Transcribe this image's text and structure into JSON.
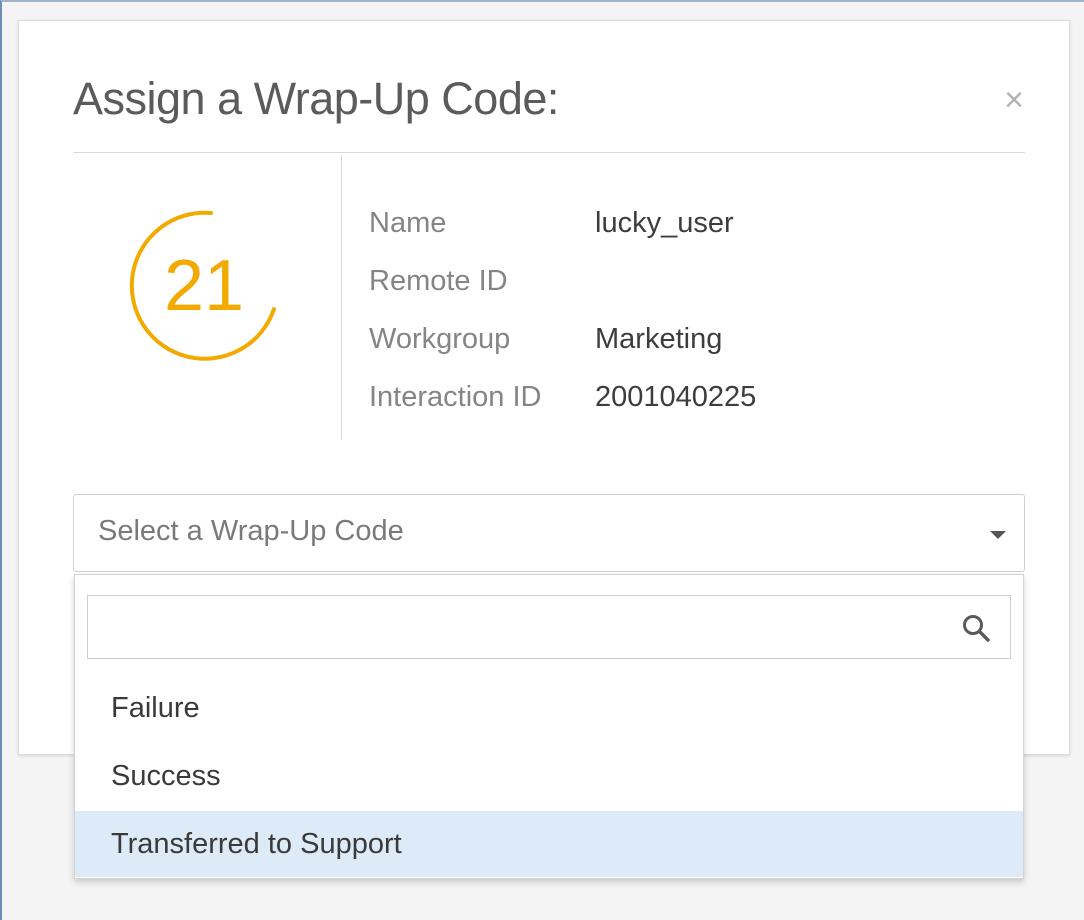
{
  "dialog": {
    "title": "Assign a Wrap-Up Code:",
    "close_label": "×"
  },
  "counter": {
    "value": "21",
    "color": "#f2a900"
  },
  "info": {
    "rows": [
      {
        "label": "Name",
        "value": "lucky_user"
      },
      {
        "label": "Remote ID",
        "value": ""
      },
      {
        "label": "Workgroup",
        "value": "Marketing"
      },
      {
        "label": "Interaction ID",
        "value": "2001040225"
      }
    ]
  },
  "select": {
    "placeholder": "Select a Wrap-Up Code",
    "icon": "chevron-down-icon"
  },
  "dropdown": {
    "search_value": "",
    "search_icon": "search-icon",
    "options": [
      {
        "label": "Failure",
        "highlighted": false
      },
      {
        "label": "Success",
        "highlighted": false
      },
      {
        "label": "Transferred to Support",
        "highlighted": true
      }
    ]
  },
  "colors": {
    "accent": "#f2a900",
    "highlight": "#dcebf7",
    "primary_blue": "#2f6fb0"
  }
}
